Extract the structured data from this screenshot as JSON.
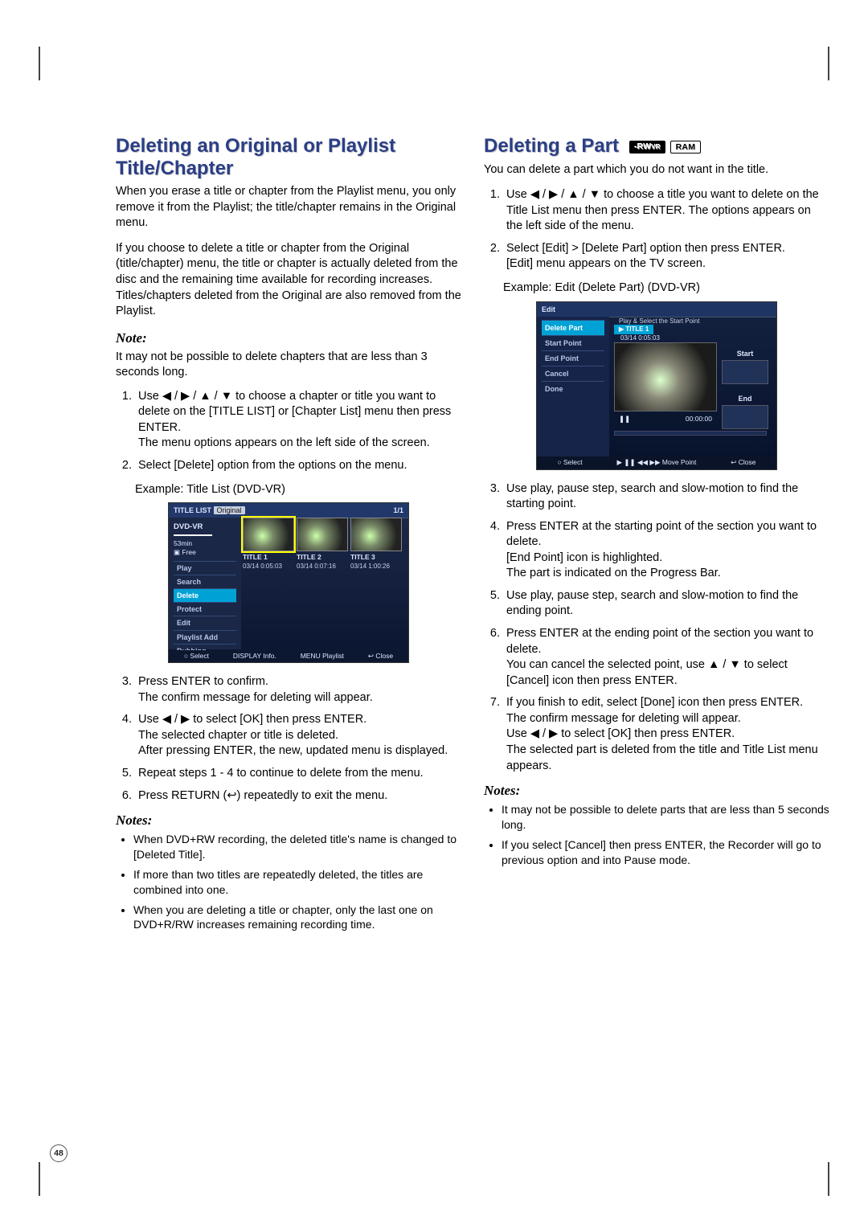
{
  "page_number": "48",
  "left": {
    "title": "Deleting an Original or Playlist Title/Chapter",
    "intro1": "When you erase a title or chapter from the Playlist menu, you only remove it from the Playlist; the title/chapter remains in the Original menu.",
    "intro2": "If you choose to delete a title or chapter from the Original (title/chapter) menu, the title or chapter is actually deleted from the disc and the remaining time available for recording increases. Titles/chapters deleted from the Original are also removed from the Playlist.",
    "note_heading": "Note:",
    "note_text": "It may not be possible to delete chapters that are less than 3 seconds long.",
    "steps_a": [
      "Use ◀ / ▶ / ▲ / ▼ to choose a chapter or title you want to delete on the [TITLE LIST] or [Chapter List] menu then press ENTER.\nThe menu options appears on the left side of the screen.",
      "Select [Delete] option from the options on the menu."
    ],
    "example_label": "Example: Title List (DVD-VR)",
    "shot1": {
      "title_label": "TITLE LIST",
      "title_tab": "Original",
      "pager": "1/1",
      "dvd_vr": "DVD-VR",
      "time_free": "53min",
      "free_icon": "Free",
      "menu": [
        "Play",
        "Search",
        "Delete",
        "Protect",
        "Edit",
        "Playlist Add",
        "Dubbing"
      ],
      "menu_selected_index": 2,
      "thumbs": [
        {
          "title": "TITLE 1",
          "meta": "03/14      0:05:03",
          "sel": true
        },
        {
          "title": "TITLE 2",
          "meta": "03/14      0:07:16",
          "sel": false
        },
        {
          "title": "TITLE 3",
          "meta": "03/14      1:00:26",
          "sel": false
        }
      ],
      "footer": [
        "○ Select",
        "DISPLAY Info.",
        "MENU Playlist",
        "↩ Close"
      ]
    },
    "steps_b": [
      "Press ENTER to confirm.\nThe confirm message for deleting will appear.",
      "Use ◀ / ▶ to select [OK] then press ENTER.\nThe selected chapter or title is deleted.\nAfter pressing ENTER, the new, updated menu is displayed.",
      "Repeat steps 1 - 4 to continue to delete from the menu.",
      "Press RETURN (↩) repeatedly to exit the menu."
    ],
    "notes_heading": "Notes:",
    "notes": [
      "When DVD+RW recording, the deleted title's name is changed to [Deleted Title].",
      "If more than two titles are repeatedly deleted, the titles are combined into one.",
      "When you are deleting a title or chapter, only the last one on DVD+R/RW increases remaining recording time."
    ]
  },
  "right": {
    "title": "Deleting a Part",
    "badges": [
      "-RWVR",
      "RAM"
    ],
    "intro": "You can delete a part which you do not want in the title.",
    "steps_a": [
      "Use ◀ / ▶ / ▲ / ▼ to choose a title you want to delete on the Title List menu then press ENTER. The options appears on the left side of the menu.",
      "Select [Edit] > [Delete Part] option then press ENTER.\n[Edit] menu appears on the TV screen."
    ],
    "example_label": "Example: Edit (Delete Part) (DVD-VR)",
    "shot2": {
      "top": "Edit",
      "hint": "Play & Select the Start Point",
      "menu": [
        "Delete Part",
        "Start Point",
        "End Point",
        "Cancel",
        "Done"
      ],
      "menu_selected_index": 0,
      "preview_title": "TITLE 1",
      "preview_meta": "03/14     0:05:03",
      "pause_icon": "❚❚",
      "preview_time": "00:00:00",
      "start_label": "Start",
      "end_label": "End",
      "footer": [
        "○ Select",
        "▶ ❚❚ ◀◀ ▶▶ Move Point",
        "↩ Close"
      ]
    },
    "steps_b": [
      "Use play, pause step, search and slow-motion to find the starting point.",
      "Press ENTER at the starting point of the section you want to delete.\n[End Point] icon is highlighted.\nThe part is indicated on the Progress Bar.",
      "Use play, pause step, search and slow-motion to find the ending point.",
      "Press ENTER at the ending point of the section you want to delete.\nYou can cancel the selected point, use ▲ / ▼ to select [Cancel] icon then press ENTER.",
      "If you finish to edit, select [Done] icon then press ENTER.\nThe confirm message for deleting will appear.\nUse ◀ / ▶ to select [OK] then press ENTER.\nThe selected part is deleted from the title and Title List menu appears."
    ],
    "notes_heading": "Notes:",
    "notes": [
      "It may not be possible to delete parts that are less than 5 seconds long.",
      "If you select [Cancel] then press ENTER, the Recorder will go to previous option and into Pause mode."
    ]
  }
}
